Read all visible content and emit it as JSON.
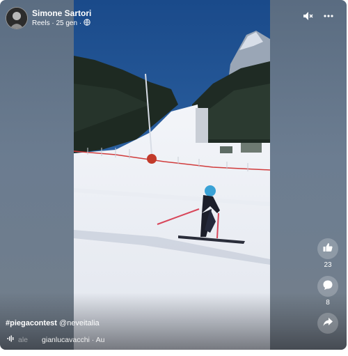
{
  "post": {
    "author_name": "Simone Sartori",
    "meta_text": "Reels · 25 gen ·",
    "privacy_icon": "globe-icon"
  },
  "top_actions": {
    "mute_icon": "speaker-muted-icon",
    "more_icon": "more-horizontal-icon"
  },
  "rail": {
    "like_count": "23",
    "comment_count": "8",
    "share_icon": "share-arrow-icon"
  },
  "caption": {
    "hashtag": "#piegacontest",
    "mention": "@neveitalia"
  },
  "audio": {
    "icon": "audio-wave-icon",
    "faded_text": "ale",
    "text": "gianlucavacchi · Au"
  },
  "colors": {
    "sky": "#1f4f8e",
    "snow": "#eef1f6",
    "panel": "#6b7c90",
    "text": "#ffffff"
  }
}
